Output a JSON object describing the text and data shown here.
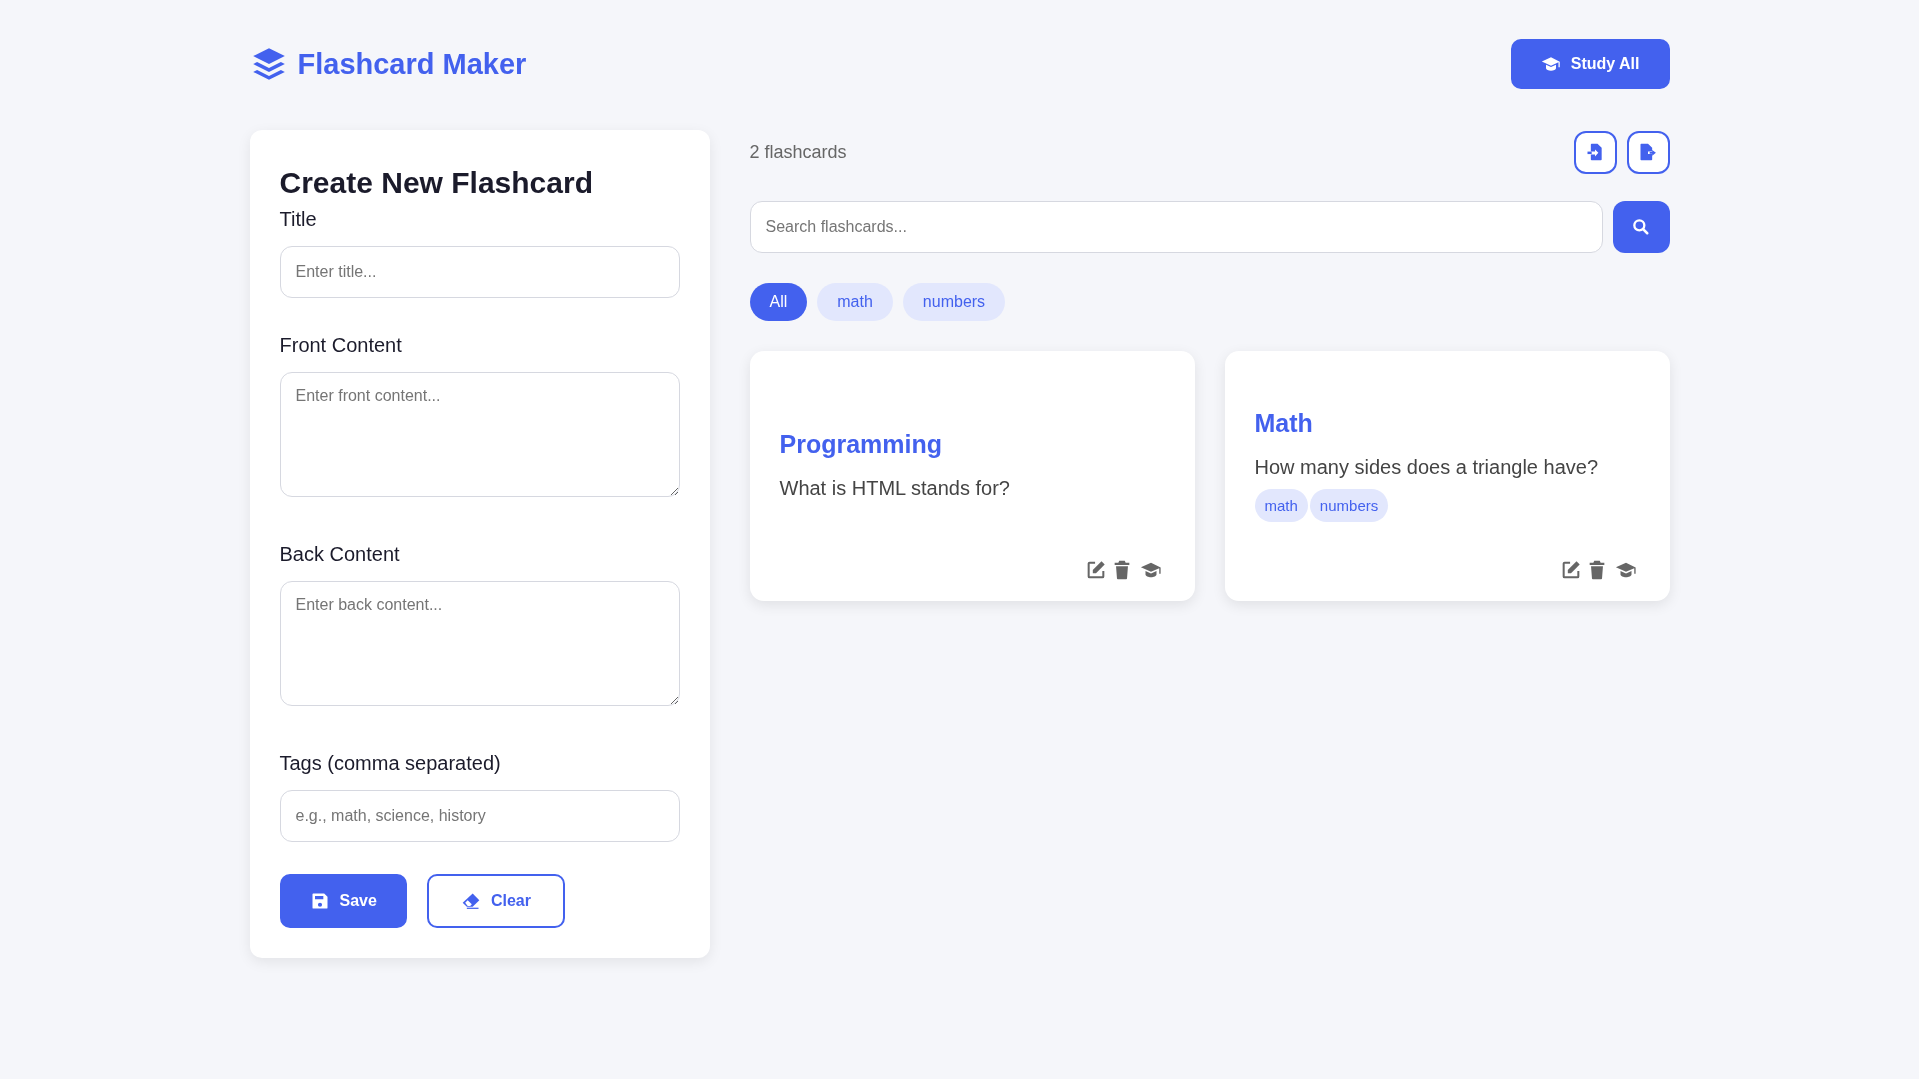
{
  "header": {
    "title": "Flashcard Maker",
    "study_button": "Study All"
  },
  "form": {
    "heading": "Create New Flashcard",
    "fields": [
      {
        "label": "Title",
        "kind": "input",
        "placeholder": "Enter title..."
      },
      {
        "label": "Front Content",
        "kind": "textarea",
        "placeholder": "Enter front content..."
      },
      {
        "label": "Back Content",
        "kind": "textarea",
        "placeholder": "Enter back content..."
      },
      {
        "label": "Tags (comma separated)",
        "kind": "input",
        "placeholder": "e.g., math, science, history"
      }
    ],
    "buttons": [
      {
        "label": "Save",
        "kind": "primary"
      },
      {
        "label": "Clear",
        "kind": "outline"
      }
    ]
  },
  "list": {
    "count": "2 flashcards",
    "search": {
      "placeholder": "Search flashcards..."
    },
    "filters": [
      {
        "label": "All",
        "selected": true
      },
      {
        "label": "math",
        "selected": false
      },
      {
        "label": "numbers",
        "selected": false
      }
    ],
    "cards": [
      {
        "title": "Programming",
        "front": "What is HTML stands for?"
      },
      {
        "title": "Math",
        "front": "How many sides does a triangle have?",
        "tags": [
          "math",
          "numbers"
        ]
      }
    ]
  }
}
